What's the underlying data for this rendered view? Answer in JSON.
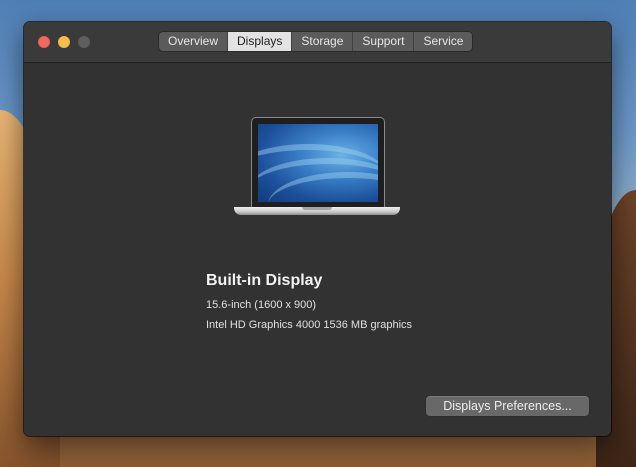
{
  "tabs": [
    {
      "label": "Overview",
      "active": false
    },
    {
      "label": "Displays",
      "active": true
    },
    {
      "label": "Storage",
      "active": false
    },
    {
      "label": "Support",
      "active": false
    },
    {
      "label": "Service",
      "active": false
    }
  ],
  "display": {
    "title": "Built-in Display",
    "size_resolution": "15.6-inch (1600 x 900)",
    "graphics": "Intel HD Graphics 4000 1536 MB graphics",
    "image_icon": "macbook-pro-icon"
  },
  "buttons": {
    "preferences_label": "Displays Preferences..."
  },
  "colors": {
    "window_bg": "#323232",
    "titlebar_bg": "#3a3a3a",
    "tab_active_bg": "#e3e3e3",
    "tab_inactive_bg": "#5b5b5b",
    "close": "#ed6a5e",
    "minimize": "#f5bf4f",
    "zoom_disabled": "#5e5e5e"
  }
}
